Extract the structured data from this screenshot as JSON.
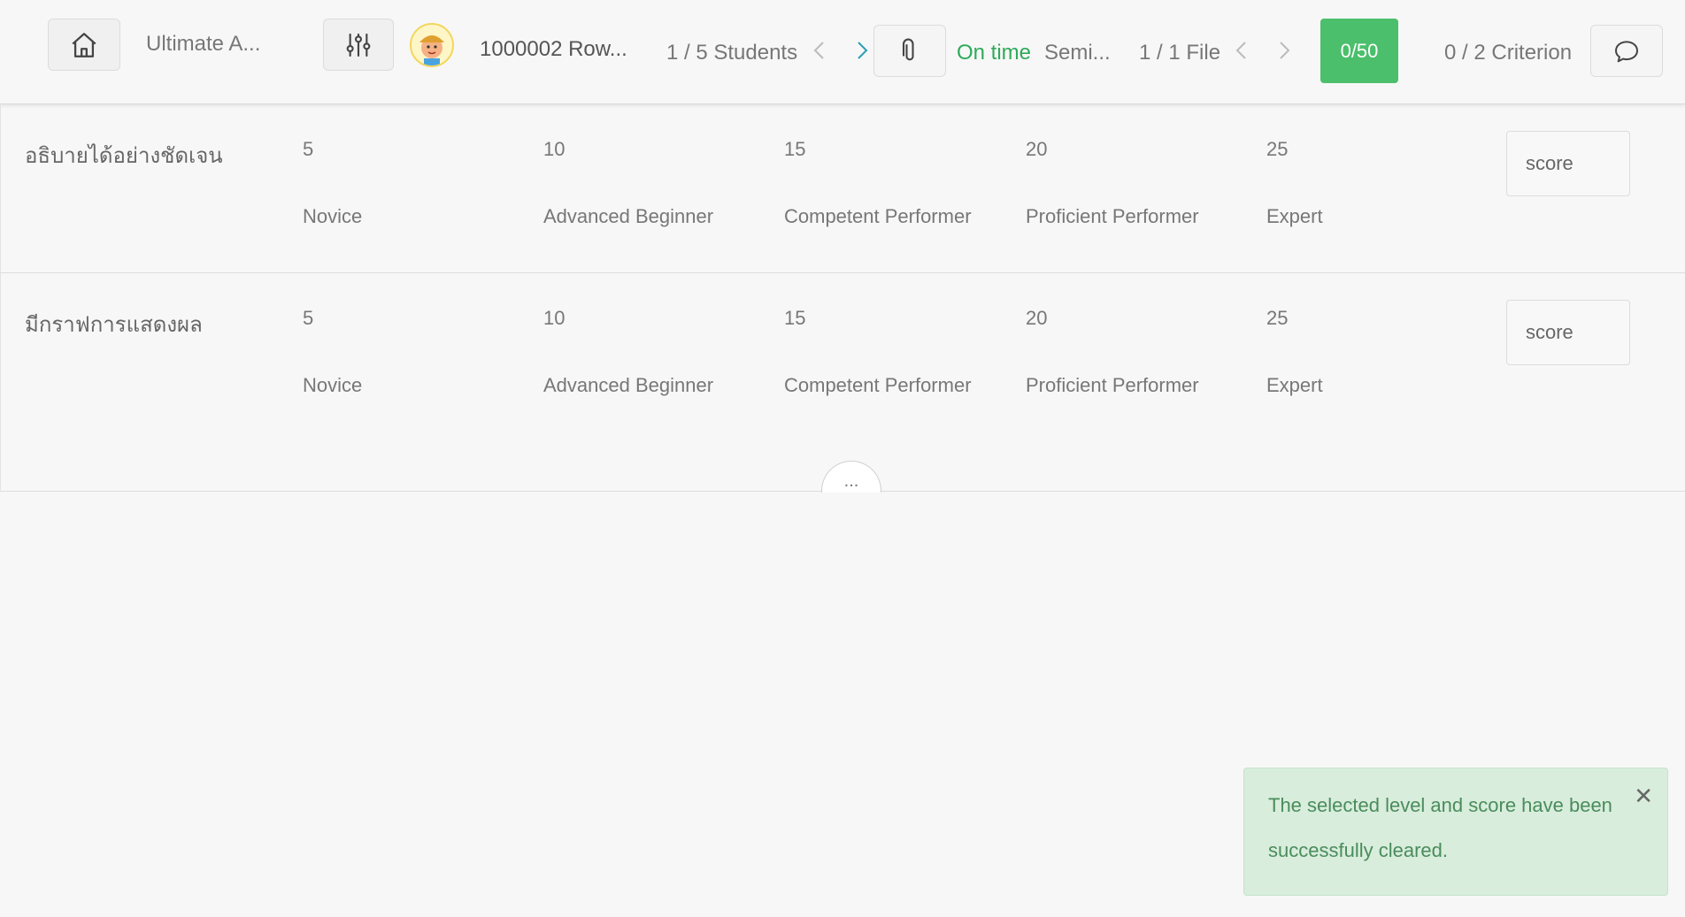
{
  "header": {
    "home_icon": "home-icon",
    "assignment_title": "Ultimate A...",
    "filter_icon": "sliders-icon",
    "student_name": "1000002 Row...",
    "student_nav": "1 / 5 Students",
    "attach_icon": "paperclip-icon",
    "submission_status": "On time",
    "file_name": "Semi...",
    "file_nav": "1 / 1 File",
    "total_score": "0/50",
    "criterion_progress": "0 / 2 Criterion",
    "comment_icon": "comment-icon",
    "colors": {
      "status_on_time": "#2eaa59",
      "score_pill": "#4bbf6b"
    }
  },
  "rubric": {
    "criteria": [
      {
        "name": "อธิบายได้อย่างชัดเจน",
        "levels": [
          {
            "score": "5",
            "label": "Novice"
          },
          {
            "score": "10",
            "label": "Advanced Beginner"
          },
          {
            "score": "15",
            "label": "Competent Performer"
          },
          {
            "score": "20",
            "label": "Proficient Performer"
          },
          {
            "score": "25",
            "label": "Expert"
          }
        ],
        "score_placeholder": "score"
      },
      {
        "name": "มีกราฟการแสดงผล",
        "levels": [
          {
            "score": "5",
            "label": "Novice"
          },
          {
            "score": "10",
            "label": "Advanced Beginner"
          },
          {
            "score": "15",
            "label": "Competent Performer"
          },
          {
            "score": "20",
            "label": "Proficient Performer"
          },
          {
            "score": "25",
            "label": "Expert"
          }
        ],
        "score_placeholder": "score"
      }
    ],
    "more_label": "..."
  },
  "toast": {
    "line1": "The selected level and score have been",
    "line2": "successfully cleared.",
    "close_label": "✕"
  }
}
